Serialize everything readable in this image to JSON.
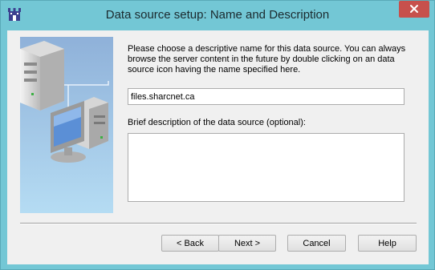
{
  "window": {
    "title": "Data source setup: Name and Description",
    "close_label": "×",
    "accent_color": "#73c7d5",
    "close_color": "#c7504c"
  },
  "icons": {
    "app": "castle-tower-icon",
    "close": "close-icon",
    "illustration": "server-network-illustration"
  },
  "content": {
    "prompt": "Please choose a descriptive name for this data source.  You can always browse the server content in the future by double clicking on an data source icon having the name specified here.",
    "name_value": "files.sharcnet.ca",
    "description_label": "Brief description of the data source (optional):",
    "description_value": ""
  },
  "buttons": {
    "back": "< Back",
    "next": "Next >",
    "cancel": "Cancel",
    "help": "Help"
  }
}
